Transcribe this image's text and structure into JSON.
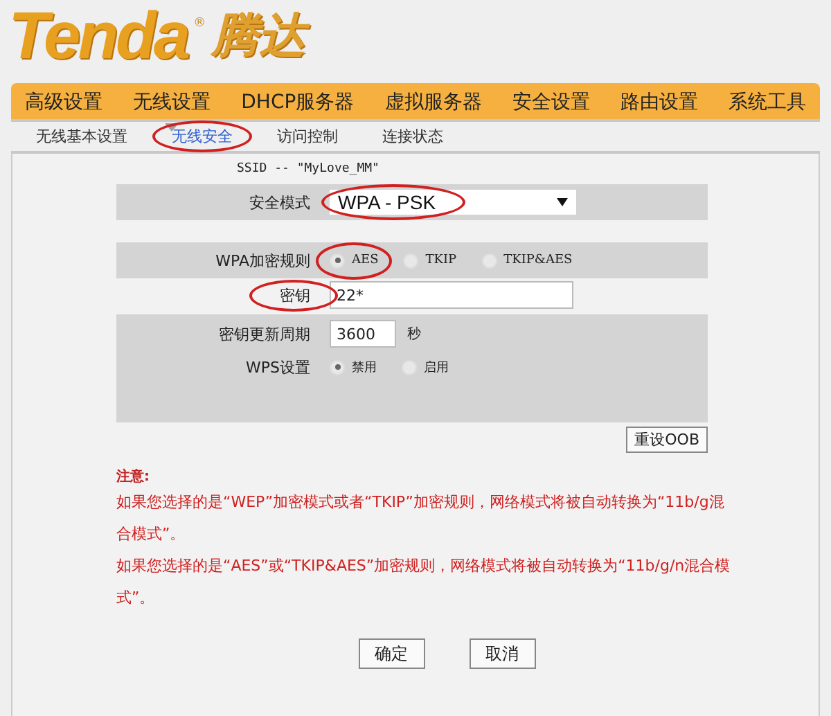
{
  "logo": {
    "brand": "Tenda",
    "mark": "®",
    "name": "腾达"
  },
  "nav": [
    {
      "label": "高级设置",
      "selected": false
    },
    {
      "label": "无线设置",
      "selected": true
    },
    {
      "label": "DHCP服务器",
      "selected": false
    },
    {
      "label": "虚拟服务器",
      "selected": false
    },
    {
      "label": "安全设置",
      "selected": false
    },
    {
      "label": "路由设置",
      "selected": false
    },
    {
      "label": "系统工具",
      "selected": false
    }
  ],
  "subtabs": [
    {
      "label": "无线基本设置",
      "selected": false,
      "circled": false
    },
    {
      "label": "无线安全",
      "selected": true,
      "circled": true
    },
    {
      "label": "访问控制",
      "selected": false,
      "circled": false
    },
    {
      "label": "连接状态",
      "selected": false,
      "circled": false
    }
  ],
  "ssid": "SSID -- \"MyLove_MM\"",
  "security_mode": {
    "label": "安全模式",
    "value": "WPA - PSK",
    "circled": true
  },
  "cipher": {
    "label": "WPA加密规则",
    "options": [
      {
        "label": "AES",
        "selected": true,
        "circled": true
      },
      {
        "label": "TKIP",
        "selected": false,
        "circled": false
      },
      {
        "label": "TKIP&AES",
        "selected": false,
        "circled": false
      }
    ]
  },
  "key": {
    "label": "密钥",
    "value": "22*",
    "circled": true
  },
  "renewal": {
    "label": "密钥更新周期",
    "value": "3600",
    "unit": "秒"
  },
  "wps": {
    "label": "WPS设置",
    "options": [
      {
        "label": "禁用",
        "selected": true
      },
      {
        "label": "启用",
        "selected": false
      }
    ]
  },
  "reset_button": "重设OOB",
  "notes": {
    "title": "注意:",
    "lines": [
      "如果您选择的是“WEP”加密模式或者“TKIP”加密规则，网络模式将被自动转换为“11b/g混合模式”。",
      "如果您选择的是“AES”或“TKIP&AES”加密规则，网络模式将被自动转换为“11b/g/n混合模式”。"
    ]
  },
  "buttons": [
    "确定",
    "取消"
  ]
}
